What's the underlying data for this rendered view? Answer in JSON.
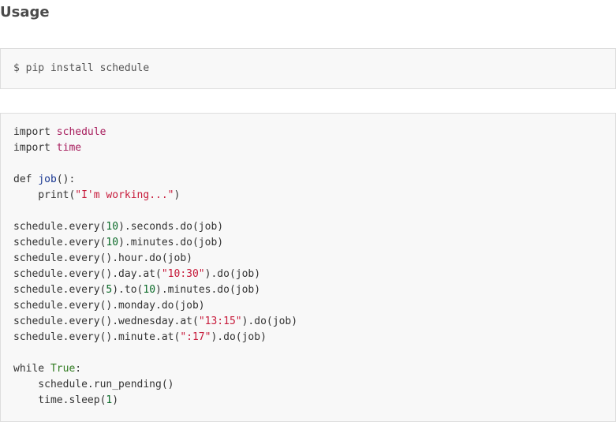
{
  "section": {
    "title": "Usage"
  },
  "install": {
    "command": "$ pip install schedule"
  },
  "code": {
    "lines": [
      {
        "parts": [
          {
            "t": "import ",
            "c": "kw"
          },
          {
            "t": "schedule",
            "c": "mod"
          }
        ]
      },
      {
        "parts": [
          {
            "t": "import ",
            "c": "kw"
          },
          {
            "t": "time",
            "c": "mod"
          }
        ]
      },
      {
        "parts": []
      },
      {
        "parts": [
          {
            "t": "def ",
            "c": "kw"
          },
          {
            "t": "job",
            "c": "fnname"
          },
          {
            "t": "():",
            "c": ""
          }
        ]
      },
      {
        "parts": [
          {
            "t": "    print(",
            "c": ""
          },
          {
            "t": "\"I'm working...\"",
            "c": "str"
          },
          {
            "t": ")",
            "c": ""
          }
        ]
      },
      {
        "parts": []
      },
      {
        "parts": [
          {
            "t": "schedule.every(",
            "c": ""
          },
          {
            "t": "10",
            "c": "num"
          },
          {
            "t": ").seconds.do(job)",
            "c": ""
          }
        ]
      },
      {
        "parts": [
          {
            "t": "schedule.every(",
            "c": ""
          },
          {
            "t": "10",
            "c": "num"
          },
          {
            "t": ").minutes.do(job)",
            "c": ""
          }
        ]
      },
      {
        "parts": [
          {
            "t": "schedule.every().hour.do(job)",
            "c": ""
          }
        ]
      },
      {
        "parts": [
          {
            "t": "schedule.every().day.at(",
            "c": ""
          },
          {
            "t": "\"10:30\"",
            "c": "str"
          },
          {
            "t": ").do(job)",
            "c": ""
          }
        ]
      },
      {
        "parts": [
          {
            "t": "schedule.every(",
            "c": ""
          },
          {
            "t": "5",
            "c": "num"
          },
          {
            "t": ").to(",
            "c": ""
          },
          {
            "t": "10",
            "c": "num"
          },
          {
            "t": ").minutes.do(job)",
            "c": ""
          }
        ]
      },
      {
        "parts": [
          {
            "t": "schedule.every().monday.do(job)",
            "c": ""
          }
        ]
      },
      {
        "parts": [
          {
            "t": "schedule.every().wednesday.at(",
            "c": ""
          },
          {
            "t": "\"13:15\"",
            "c": "str"
          },
          {
            "t": ").do(job)",
            "c": ""
          }
        ]
      },
      {
        "parts": [
          {
            "t": "schedule.every().minute.at(",
            "c": ""
          },
          {
            "t": "\":17\"",
            "c": "str"
          },
          {
            "t": ").do(job)",
            "c": ""
          }
        ]
      },
      {
        "parts": []
      },
      {
        "parts": [
          {
            "t": "while ",
            "c": "kw"
          },
          {
            "t": "True",
            "c": "bool"
          },
          {
            "t": ":",
            "c": ""
          }
        ]
      },
      {
        "parts": [
          {
            "t": "    schedule.run_pending()",
            "c": ""
          }
        ]
      },
      {
        "parts": [
          {
            "t": "    time.sleep(",
            "c": ""
          },
          {
            "t": "1",
            "c": "num"
          },
          {
            "t": ")",
            "c": ""
          }
        ]
      }
    ]
  }
}
